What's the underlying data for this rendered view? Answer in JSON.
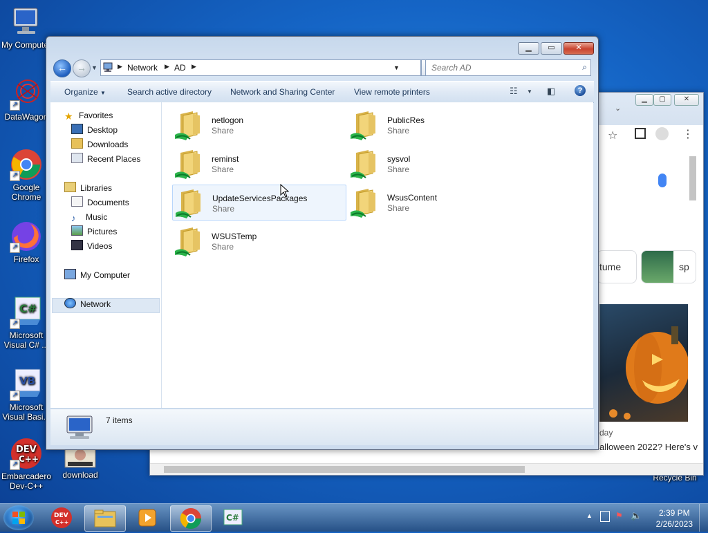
{
  "desktop": {
    "icons": [
      {
        "label": "My Computer"
      },
      {
        "label": "DataWagon"
      },
      {
        "label": "Google Chrome"
      },
      {
        "label": "Firefox"
      },
      {
        "label": "Microsoft Visual C# ..."
      },
      {
        "label": "Microsoft Visual Basi..."
      },
      {
        "label": "Embarcadero Dev-C++"
      },
      {
        "label": "download"
      },
      {
        "label": "Recycle Bin"
      }
    ]
  },
  "chrome_window": {
    "chip_text": "tume",
    "chip2_text": "sp",
    "caption_day": "day",
    "caption_headline": "alloween 2022? Here's v"
  },
  "explorer": {
    "address": {
      "root_icon": "network-icon",
      "crumbs": [
        "Network",
        "AD"
      ]
    },
    "search": {
      "placeholder": "Search AD"
    },
    "commands": {
      "organize": "Organize",
      "search_ad": "Search active directory",
      "network_sharing": "Network and Sharing Center",
      "view_printers": "View remote printers"
    },
    "nav": {
      "favorites": "Favorites",
      "desktop": "Desktop",
      "downloads": "Downloads",
      "recent": "Recent Places",
      "libraries": "Libraries",
      "documents": "Documents",
      "music": "Music",
      "pictures": "Pictures",
      "videos": "Videos",
      "my_computer": "My Computer",
      "network": "Network"
    },
    "items": [
      {
        "name": "netlogon",
        "type": "Share"
      },
      {
        "name": "PublicRes",
        "type": "Share"
      },
      {
        "name": "reminst",
        "type": "Share"
      },
      {
        "name": "sysvol",
        "type": "Share"
      },
      {
        "name": "UpdateServicesPackages",
        "type": "Share"
      },
      {
        "name": "WsusContent",
        "type": "Share"
      },
      {
        "name": "WSUSTemp",
        "type": "Share"
      }
    ],
    "status": {
      "count": "7 items"
    }
  },
  "taskbar": {
    "time": "2:39 PM",
    "date": "2/26/2023"
  },
  "colors": {
    "accent": "#1c5cc4",
    "desktop": "#1565c6",
    "selection": "#dde8f4"
  }
}
